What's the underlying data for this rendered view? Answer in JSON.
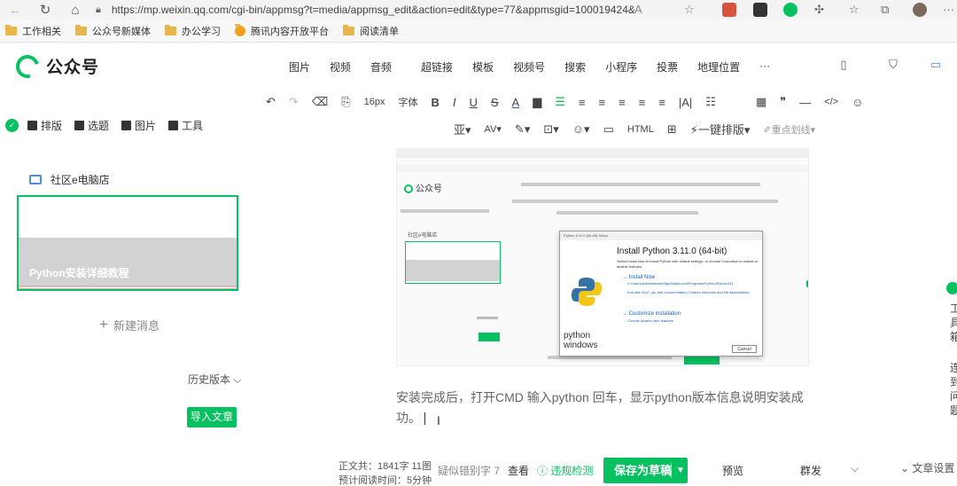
{
  "browser": {
    "url": "https://mp.weixin.qq.com/cgi-bin/appmsg?t=media/appmsg_edit&action=edit&type=77&appmsgid=100019424&...",
    "bookmarks": [
      "工作相关",
      "公众号新媒体",
      "办公学习",
      "腾讯内容开放平台",
      "阅读清单"
    ]
  },
  "header": {
    "logo_text": "公众号",
    "insert_menu": [
      "图片",
      "视频",
      "音频",
      "超链接",
      "模板",
      "视频号",
      "搜索",
      "小程序",
      "投票",
      "地理位置",
      "···"
    ]
  },
  "toolbar1": {
    "font_size": "16px",
    "font_family": "字体"
  },
  "toolbar2": {
    "one_key_layout": "一键排版",
    "key_highlight": "重点划线"
  },
  "left_panel": {
    "tabs": [
      "排版",
      "选题",
      "图片",
      "工具"
    ],
    "account_name": "社区e电脑店",
    "article_title": "Python安装详细教程",
    "new_message": "新建消息",
    "history": "历史版本",
    "import_button": "导入文章"
  },
  "embedded": {
    "logo_text": "公众号",
    "shop_name": "社区e电脑店",
    "installer_window_title": "Python 3.11.0 (64-bit) Setup",
    "installer_title": "Install Python 3.11.0 (64-bit)",
    "installer_subtitle": "Select Install Now to install Python with default settings, or choose Customize to enable or disable features.",
    "install_now": "Install Now",
    "install_now_path": "C:\\Users\\Administrator\\AppData\\Local\\Programs\\Python\\Python311",
    "install_now_desc": "Includes IDLE, pip and documentation Creates shortcuts and file associations",
    "customize": "Customize installation",
    "customize_desc": "Choose location and features",
    "python_word": "python",
    "windows_word": "windows",
    "cancel": "Cancel"
  },
  "editor": {
    "body_text": "安装完成后，打开CMD 输入python 回车，显示python版本信息说明安装成功。"
  },
  "right_sidebar": {
    "text1": "工具箱",
    "text2": "连到问题"
  },
  "status_bar": {
    "word_count": "正文共：1841字 11图",
    "read_time": "预计阅读时间：5分钟",
    "typo_label": "疑似错别字",
    "typo_count": "7",
    "view": "查看",
    "violation_check": "违规检测",
    "save_draft": "保存为草稿",
    "preview": "预览",
    "mass_send": "群发",
    "article_settings": "文章设置"
  },
  "colors": {
    "brand_green": "#07c160",
    "link_blue": "#1560bd"
  }
}
